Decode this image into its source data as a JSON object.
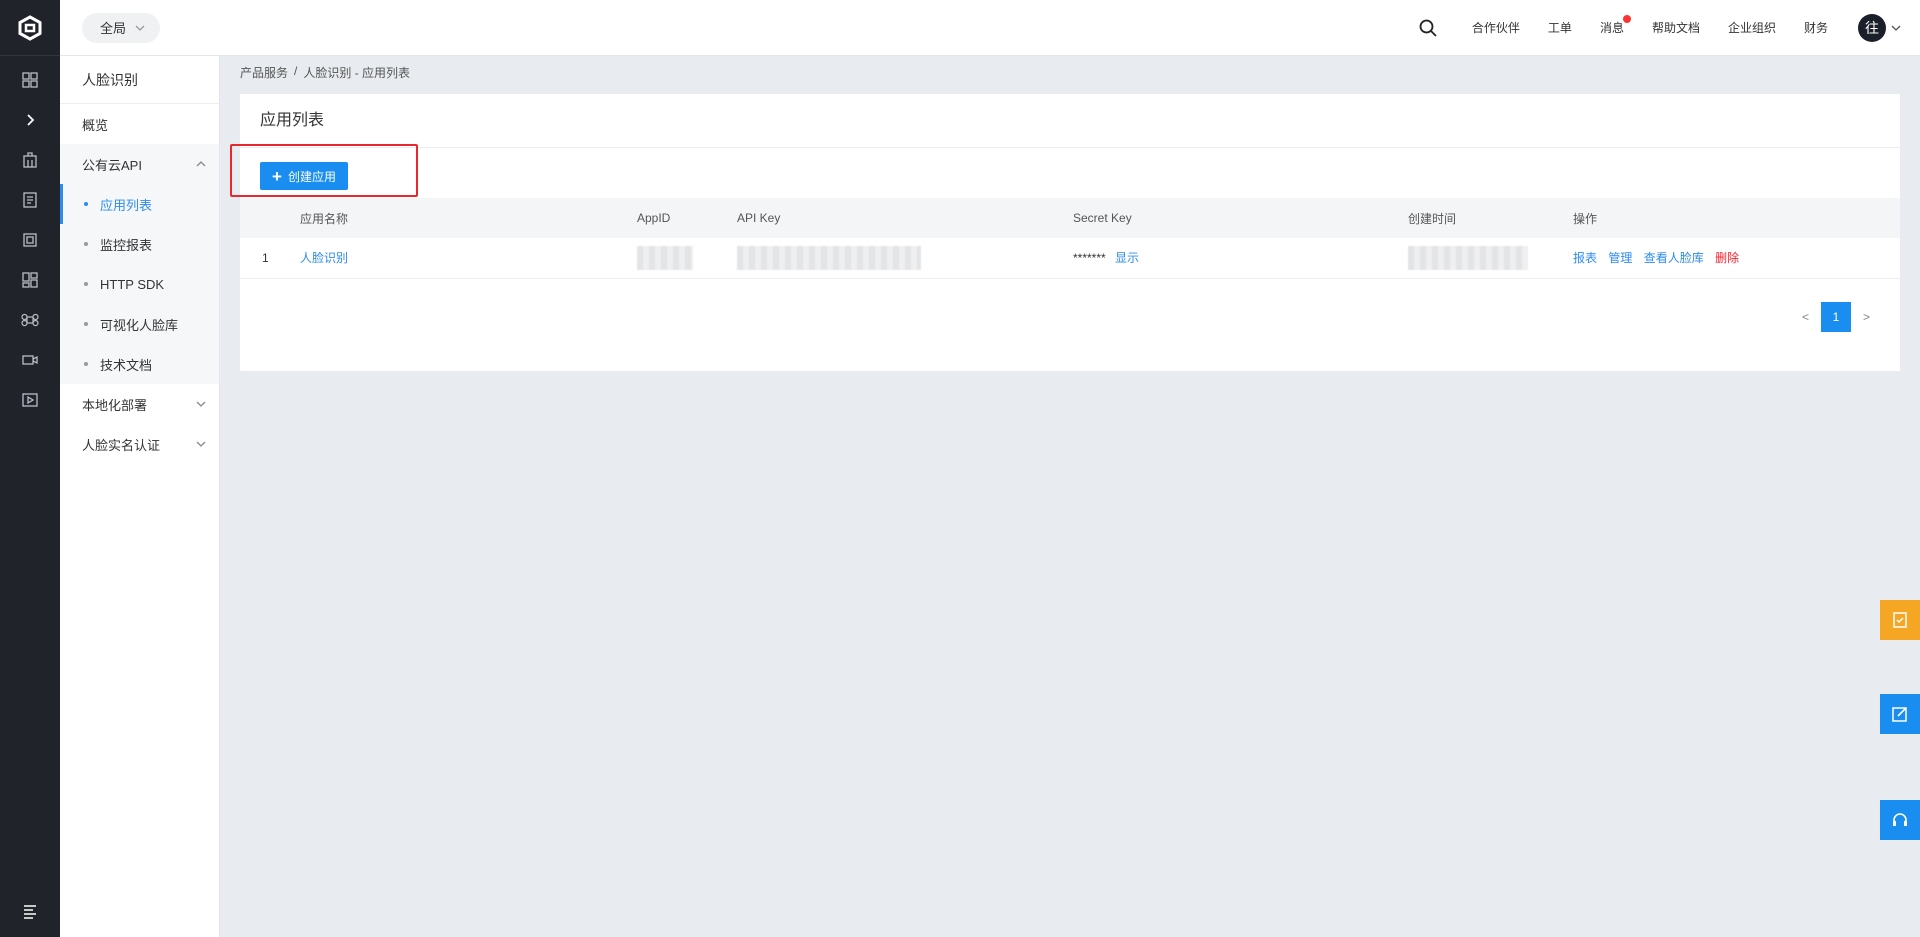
{
  "topbar": {
    "region": "全局",
    "nav": [
      {
        "label": "合作伙伴"
      },
      {
        "label": "工单"
      },
      {
        "label": "消息"
      },
      {
        "label": "帮助文档"
      },
      {
        "label": "企业组织"
      },
      {
        "label": "财务"
      }
    ],
    "avatar_text": "往"
  },
  "sidebar": {
    "title": "人脸识别",
    "overview": "概览",
    "public_api": "公有云API",
    "sub_items": [
      {
        "label": "应用列表"
      },
      {
        "label": "监控报表"
      },
      {
        "label": "HTTP SDK"
      },
      {
        "label": "可视化人脸库"
      },
      {
        "label": "技术文档"
      }
    ],
    "local_deploy": "本地化部署",
    "realname": "人脸实名认证"
  },
  "breadcrumb": {
    "root": "产品服务",
    "sep": "/",
    "current": "人脸识别 - 应用列表"
  },
  "card": {
    "title": "应用列表",
    "create_label": "创建应用"
  },
  "table": {
    "headers": [
      "应用名称",
      "AppID",
      "API Key",
      "Secret Key",
      "创建时间",
      "操作"
    ],
    "rows": [
      {
        "index": "1",
        "name": "人脸识别",
        "secret_mask": "*******",
        "show": "显示",
        "ops": [
          "报表",
          "管理",
          "查看人脸库",
          "删除"
        ]
      }
    ]
  },
  "pager": {
    "prev": "<",
    "page": "1",
    "next": ">"
  },
  "colors": {
    "accent": "#1a8df0",
    "highlight": "#e5292f",
    "rail_bg": "#20232a",
    "float_orange": "#f5a623",
    "danger": "#f5222d"
  }
}
